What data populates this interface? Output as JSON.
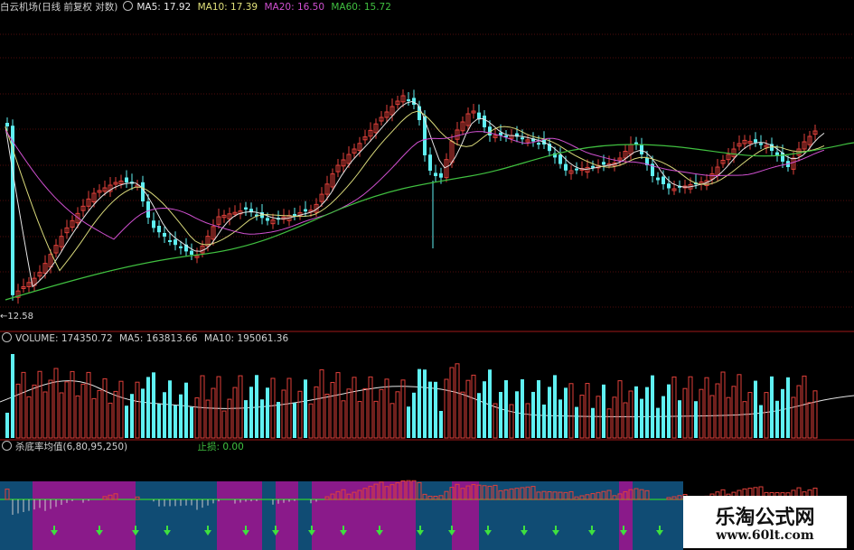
{
  "colors": {
    "up": "#e0403a",
    "down": "#5ff0f2",
    "ma5": "#e6e6e6",
    "ma10": "#d8d87a",
    "ma20": "#d050d0",
    "ma60": "#40c040",
    "grid": "#6a1010",
    "indicator_purple": "#8a1a8a",
    "indicator_blue": "#104c74",
    "indicator_line": "#2fd02f",
    "arrow": "#3fe03f"
  },
  "price_panel": {
    "title": "白云机场(日线 前复权 对数)",
    "ma5": "MA5: 17.92",
    "ma10": "MA10: 17.39",
    "ma20": "MA20: 16.50",
    "ma60": "MA60: 15.72",
    "low_label": "←12.58"
  },
  "volume_panel": {
    "volume": "VOLUME: 174350.72",
    "ma5": "MA5: 163813.66",
    "ma10": "MA10: 195061.36"
  },
  "indicator_panel": {
    "name": "杀底率均值(6,80,95,250)",
    "stop_loss": "止损: 0.00"
  },
  "watermark": {
    "line1": "乐淘公式网",
    "line2": "www.60lt.com"
  }
}
